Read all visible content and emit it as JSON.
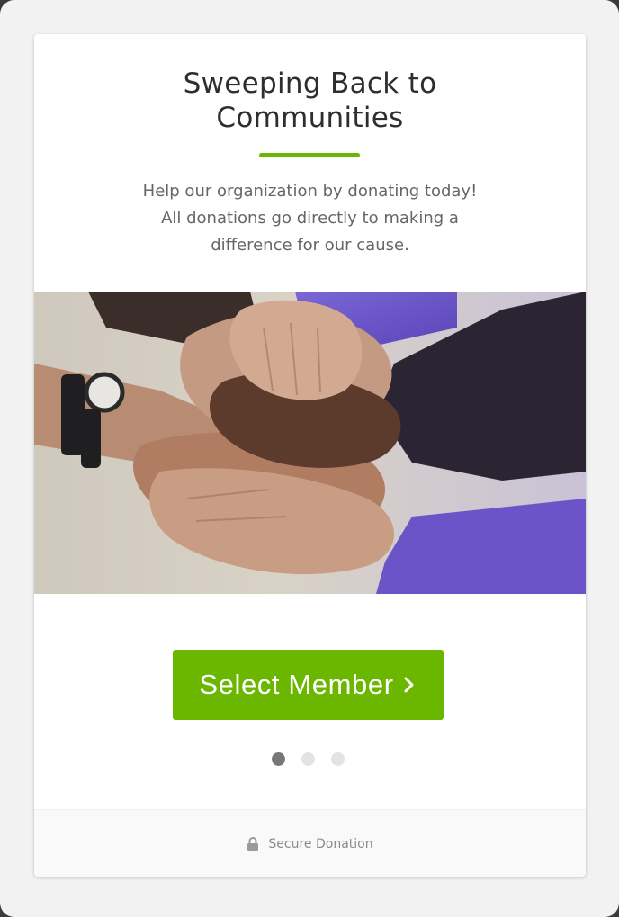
{
  "card": {
    "title_line_1": "Sweeping Back to",
    "title_line_2": "Communities",
    "description_line_1": "Help our organization by donating today!",
    "description_line_2": "All donations go directly to making a",
    "description_line_3": "difference for our cause."
  },
  "hero": {
    "image_subject": "stacked-hands-teamwork-photo"
  },
  "cta": {
    "label": "Select Member",
    "icon": "chevron-right-icon"
  },
  "pager": {
    "total_steps": 3,
    "current_step": 1
  },
  "footer": {
    "label": "Secure Donation",
    "icon": "lock-icon"
  },
  "colors": {
    "accent": "#6bb700",
    "title": "#2e2e2e",
    "body_text": "#666666",
    "footer_text": "#8a8a8a",
    "dot_active": "#777777",
    "dot_inactive": "#e3e3e3"
  }
}
